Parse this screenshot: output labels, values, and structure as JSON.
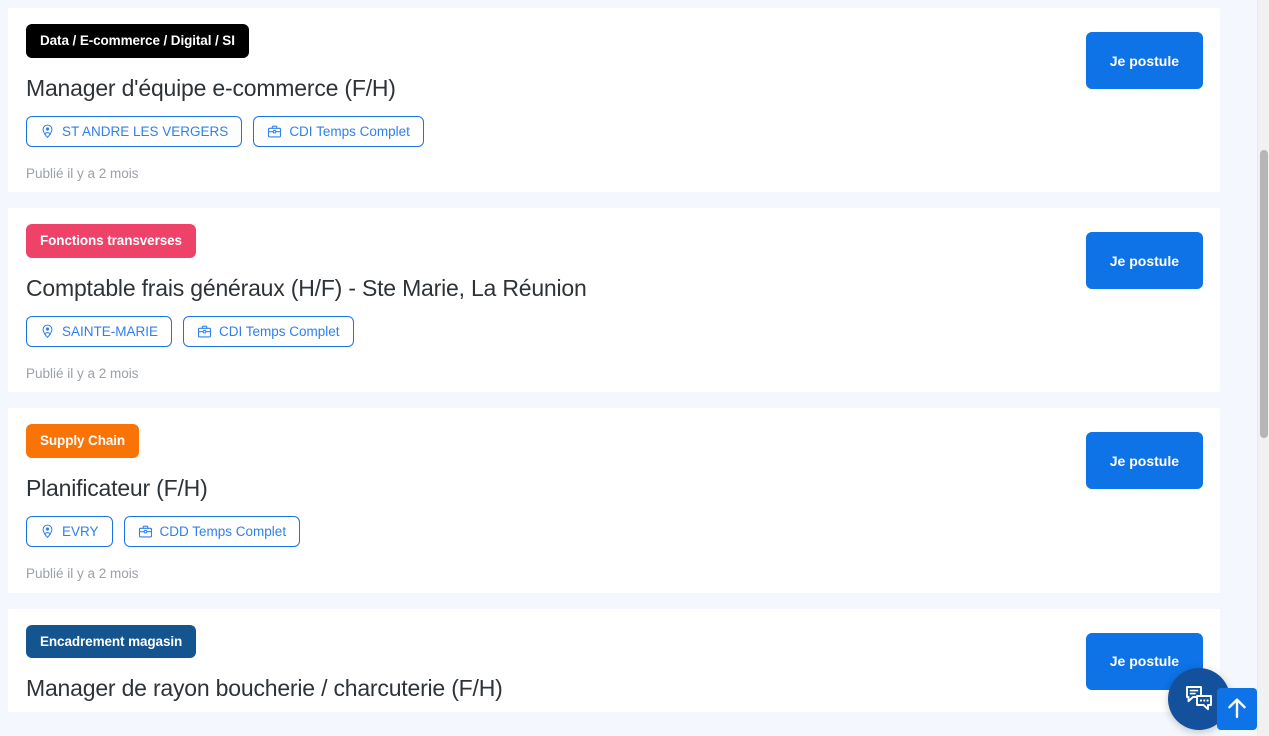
{
  "page": {
    "background_color": "#f4f7fd",
    "card_background": "#ffffff",
    "accent_color": "#0d73e6",
    "pill_border_color": "#1a73e8",
    "pill_text_color": "#2f80ed",
    "published_text_color": "#9ba1a8"
  },
  "jobs": [
    {
      "badge": {
        "label": "Data / E-commerce / Digital / SI",
        "color": "#000000"
      },
      "title": "Manager d'équipe e-commerce (F/H)",
      "location": {
        "icon": "location-pin-icon",
        "label": "ST ANDRE LES VERGERS"
      },
      "contract": {
        "icon": "briefcase-icon",
        "label": "CDI Temps Complet"
      },
      "published": "Publié il y a 2 mois",
      "apply_label": "Je postule"
    },
    {
      "badge": {
        "label": "Fonctions transverses",
        "color": "#ef4268"
      },
      "title": "Comptable frais généraux (H/F) - Ste Marie, La Réunion",
      "location": {
        "icon": "location-pin-icon",
        "label": "SAINTE-MARIE"
      },
      "contract": {
        "icon": "briefcase-icon",
        "label": "CDI Temps Complet"
      },
      "published": "Publié il y a 2 mois",
      "apply_label": "Je postule"
    },
    {
      "badge": {
        "label": "Supply Chain",
        "color": "#f97306"
      },
      "title": "Planificateur (F/H)",
      "location": {
        "icon": "location-pin-icon",
        "label": "EVRY"
      },
      "contract": {
        "icon": "briefcase-icon",
        "label": "CDD Temps Complet"
      },
      "published": "Publié il y a 2 mois",
      "apply_label": "Je postule"
    },
    {
      "badge": {
        "label": "Encadrement magasin",
        "color": "#14558f"
      },
      "title": "Manager de rayon boucherie / charcuterie (F/H)",
      "location": {
        "icon": "location-pin-icon",
        "label": ""
      },
      "contract": {
        "icon": "briefcase-icon",
        "label": ""
      },
      "published": "",
      "apply_label": "Je postule"
    }
  ],
  "widgets": {
    "chat": {
      "icon": "chat-bubbles-icon",
      "color": "#13519c"
    },
    "scroll_top": {
      "icon": "arrow-up-icon",
      "color": "#0d73e6"
    }
  },
  "scrollbar": {
    "track_color": "#f1f1f1",
    "thumb_color": "#b6b6b6"
  }
}
